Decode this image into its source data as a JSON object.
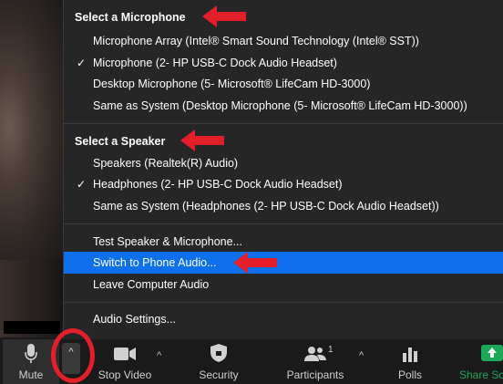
{
  "microphone_section": {
    "title": "Select a Microphone",
    "items": [
      {
        "label": "Microphone Array (Intel® Smart Sound Technology (Intel® SST))",
        "checked": false
      },
      {
        "label": "Microphone (2- HP USB-C Dock Audio Headset)",
        "checked": true
      },
      {
        "label": "Desktop Microphone (5- Microsoft® LifeCam HD-3000)",
        "checked": false
      },
      {
        "label": "Same as System (Desktop Microphone (5- Microsoft® LifeCam HD-3000))",
        "checked": false
      }
    ]
  },
  "speaker_section": {
    "title": "Select a Speaker",
    "items": [
      {
        "label": "Speakers (Realtek(R) Audio)",
        "checked": false
      },
      {
        "label": "Headphones (2- HP USB-C Dock Audio Headset)",
        "checked": true
      },
      {
        "label": "Same as System (Headphones (2- HP USB-C Dock Audio Headset))",
        "checked": false
      }
    ]
  },
  "actions": {
    "test": "Test Speaker & Microphone...",
    "switch_phone": "Switch to Phone Audio...",
    "leave": "Leave Computer Audio",
    "settings": "Audio Settings..."
  },
  "check_glyph": "✓",
  "caret_glyph": "^",
  "toolbar": {
    "mute": "Mute",
    "stop_video": "Stop Video",
    "security": "Security",
    "participants": "Participants",
    "participants_count": "1",
    "polls": "Polls",
    "share": "Share Scr"
  },
  "colors": {
    "menu_bg": "#262626",
    "highlight": "#0e71eb",
    "annotation_red": "#e3202a",
    "share_green": "#1ea85a"
  }
}
